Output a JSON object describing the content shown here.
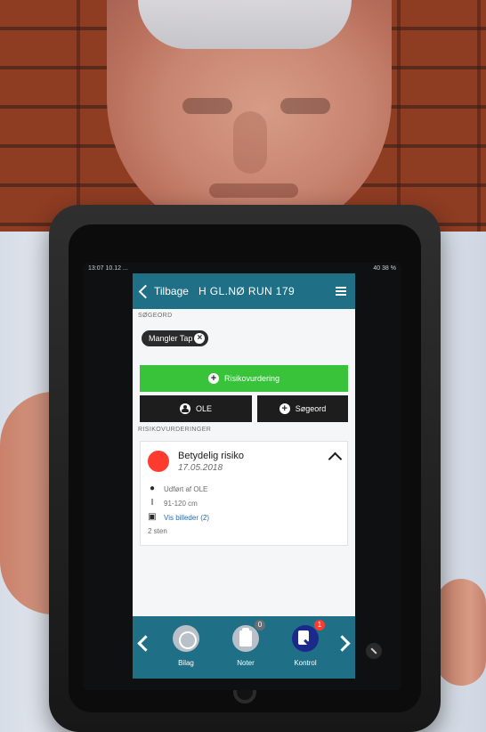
{
  "status_bar": {
    "left": "13:07  10.12  ...",
    "right": "40  38 % "
  },
  "app": {
    "back_label": "Tilbage",
    "title": "H GL.NØ RUN 179",
    "sections": {
      "search_terms": "SØGEORD",
      "risk_assessments": "RISIKOVURDERINGER"
    },
    "chip_label": "Mangler Tap",
    "buttons": {
      "risk_assessment": "Risikovurdering",
      "ole": "OLE",
      "search_term": "Søgeord"
    },
    "risk_card": {
      "title": "Betydelig risiko",
      "date": "17.05.2018",
      "by": "Udført af OLE",
      "range": "91-120 cm",
      "images_link": "Vis billeder (2)",
      "count_text": "2 sten"
    },
    "tabbar": {
      "tabs": [
        {
          "label": "Bilag",
          "icon": "paperclip-icon",
          "badge": ""
        },
        {
          "label": "Noter",
          "icon": "clipboard-icon",
          "badge": "0"
        },
        {
          "label": "Kontrol",
          "icon": "checklist-icon",
          "badge": "1"
        }
      ]
    }
  },
  "colors": {
    "primary": "#1f6f86",
    "green": "#38c33b",
    "danger": "#ff3b2f",
    "dark": "#1d1d1d"
  }
}
